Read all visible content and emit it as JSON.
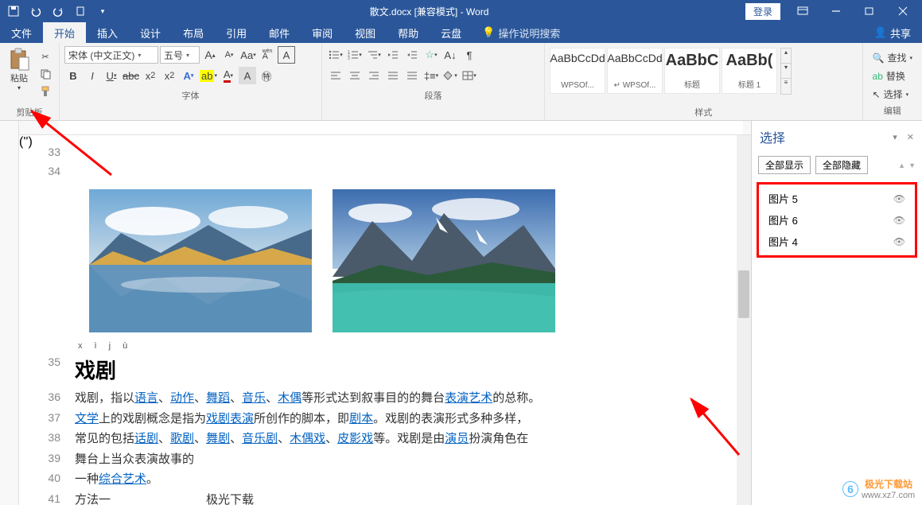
{
  "title": "散文.docx [兼容模式] - Word",
  "login": "登录",
  "tabs": {
    "file": "文件",
    "home": "开始",
    "insert": "插入",
    "design": "设计",
    "layout": "布局",
    "references": "引用",
    "mailings": "邮件",
    "review": "审阅",
    "view": "视图",
    "help": "帮助",
    "cloud": "云盘",
    "tellme": "操作说明搜索",
    "share": "共享"
  },
  "ribbon": {
    "paste": "粘贴",
    "group_clipboard": "剪贴板",
    "font_name": "宋体 (中文正文)",
    "font_size": "五号",
    "group_font": "字体",
    "group_paragraph": "段落",
    "styles": {
      "s1_prev": "AaBbCcDd",
      "s1_name": "WPSOf...",
      "s2_prev": "AaBbCcDd",
      "s2_name": "↵ WPSOf...",
      "s3_prev": "AaBbC",
      "s3_name": "标题",
      "s4_prev": "AaBb(",
      "s4_name": "标题 1"
    },
    "group_styles": "样式",
    "find": "查找",
    "replace": "替换",
    "select": "选择",
    "group_editing": "编辑"
  },
  "doc": {
    "pinyin": "x ì  j ù",
    "heading": "戏剧",
    "l32": "",
    "l33": "",
    "l34": "",
    "line36_a": "戏剧，指以",
    "line36_lang": "语言",
    "line36_s1": "、",
    "line36_act": "动作",
    "line36_s2": "、",
    "line36_dance": "舞蹈",
    "line36_s3": "、",
    "line36_music": "音乐",
    "line36_s4": "、",
    "line36_puppet": "木偶",
    "line36_b": "等形式达到叙事目的的舞台",
    "line36_perf": "表演艺术",
    "line36_c": "的总称。",
    "line37_lit": "文学",
    "line37_a": "上的戏剧概念是指为",
    "line37_drama": "戏剧表演",
    "line37_b": "所创作的脚本，即",
    "line37_script": "剧本",
    "line37_c": "。戏剧的表演形式多种多样，",
    "line38_a": "常见的包括",
    "line38_spoken": "话剧",
    "line38_s1": "、",
    "line38_opera": "歌剧",
    "line38_s2": "、",
    "line38_dance": "舞剧",
    "line38_s3": "、",
    "line38_musical": "音乐剧",
    "line38_s4": "、",
    "line38_puppet": "木偶戏",
    "line38_s5": "、",
    "line38_shadow": "皮影戏",
    "line38_b": "等。戏剧是由",
    "line38_actor": "演员",
    "line38_c": "扮演角色在",
    "line39": "舞台上当众表演故事的",
    "line40_a": "一种",
    "line40_art": "综合艺术",
    "line40_b": "。",
    "line41_a": "方法一",
    "line41_b": "极光下载"
  },
  "selpane": {
    "title": "选择",
    "show_all": "全部显示",
    "hide_all": "全部隐藏",
    "items": {
      "i0": "图片 5",
      "i1": "图片 6",
      "i2": "图片 4"
    }
  },
  "watermark": {
    "text": "极光下载站",
    "url": "www.xz7.com"
  }
}
